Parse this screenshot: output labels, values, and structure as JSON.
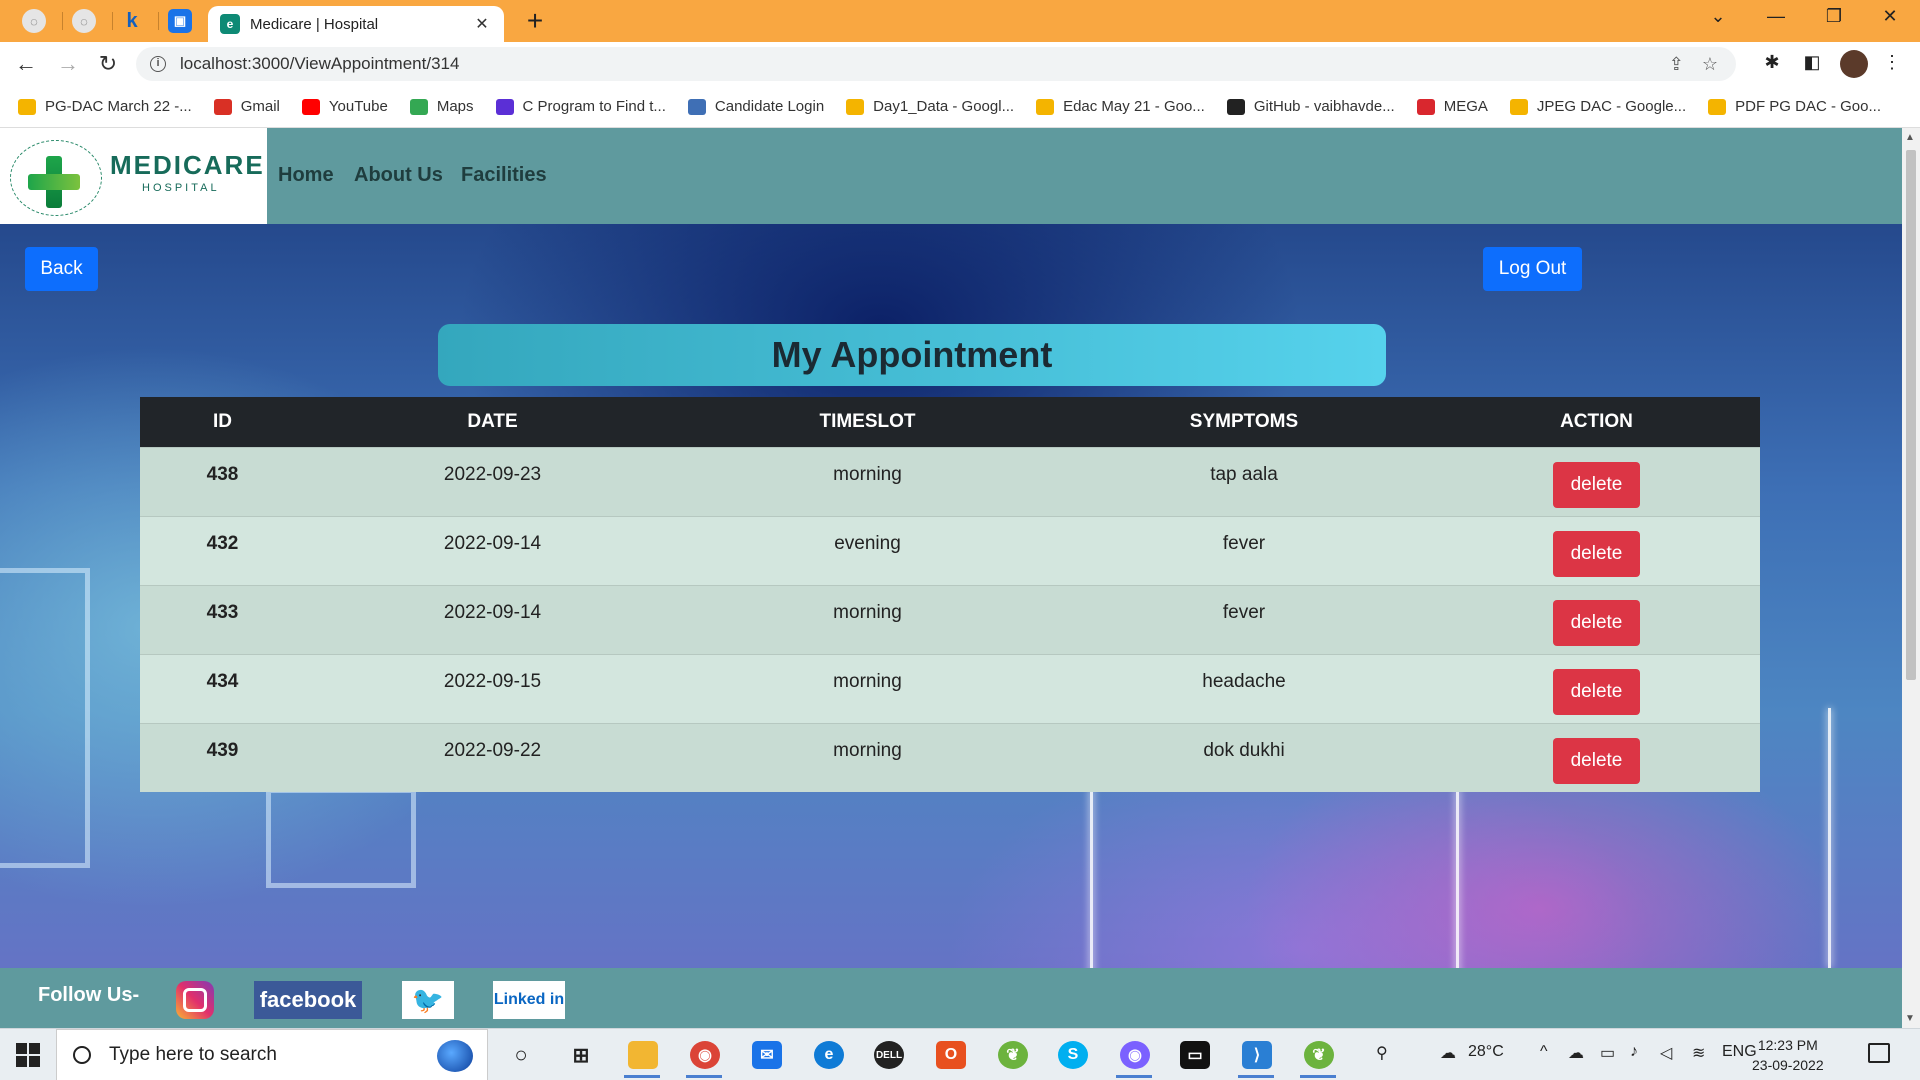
{
  "browser": {
    "active_tab_title": "Medicare | Hospital",
    "url": "localhost:3000/ViewAppointment/314",
    "bookmarks": [
      {
        "label": "PG-DAC March 22 -...",
        "icon": "google-drive-icon",
        "color": "#f4b400"
      },
      {
        "label": "Gmail",
        "icon": "gmail-icon",
        "color": "#d93025"
      },
      {
        "label": "YouTube",
        "icon": "youtube-icon",
        "color": "#ff0000"
      },
      {
        "label": "Maps",
        "icon": "maps-icon",
        "color": "#34a853"
      },
      {
        "label": "C Program to Find t...",
        "icon": "programiz-icon",
        "color": "#5b2fd6"
      },
      {
        "label": "Candidate Login",
        "icon": "cdac-icon",
        "color": "#3f6fb5"
      },
      {
        "label": "Day1_Data - Googl...",
        "icon": "google-drive-icon",
        "color": "#f4b400"
      },
      {
        "label": "Edac May 21 - Goo...",
        "icon": "google-drive-icon",
        "color": "#f4b400"
      },
      {
        "label": "GitHub - vaibhavde...",
        "icon": "github-icon",
        "color": "#222222"
      },
      {
        "label": "MEGA",
        "icon": "mega-icon",
        "color": "#d9272e"
      },
      {
        "label": "JPEG DAC - Google...",
        "icon": "google-drive-icon",
        "color": "#f4b400"
      },
      {
        "label": "PDF PG DAC - Goo...",
        "icon": "google-drive-icon",
        "color": "#f4b400"
      }
    ]
  },
  "site": {
    "logo_title": "MEDICARE",
    "logo_subtitle": "HOSPITAL",
    "logo_ring_text": "HEALING HANDS CARING HEARTS",
    "nav": [
      "Home",
      "About Us",
      "Facilities"
    ],
    "back_label": "Back",
    "logout_label": "Log Out",
    "heading": "My Appointment",
    "columns": [
      "ID",
      "DATE",
      "TIMESLOT",
      "SYMPTOMS",
      "ACTION"
    ],
    "rows": [
      {
        "id": "438",
        "date": "2022-09-23",
        "timeslot": "morning",
        "symptoms": "tap aala",
        "action": "delete"
      },
      {
        "id": "432",
        "date": "2022-09-14",
        "timeslot": "evening",
        "symptoms": "fever",
        "action": "delete"
      },
      {
        "id": "433",
        "date": "2022-09-14",
        "timeslot": "morning",
        "symptoms": "fever",
        "action": "delete"
      },
      {
        "id": "434",
        "date": "2022-09-15",
        "timeslot": "morning",
        "symptoms": "headache",
        "action": "delete"
      },
      {
        "id": "439",
        "date": "2022-09-22",
        "timeslot": "morning",
        "symptoms": "dok dukhi",
        "action": "delete"
      }
    ],
    "footer": {
      "follow_label": "Follow Us-",
      "facebook": "facebook",
      "linkedin": "Linked in"
    },
    "colors": {
      "primary": "#0d6efd",
      "danger": "#dc3545",
      "header": "#5f9a9e",
      "table_head": "#212529"
    }
  },
  "taskbar": {
    "search_placeholder": "Type here to search",
    "temperature": "28°C",
    "language": "ENG",
    "time": "12:23 PM",
    "date": "23-09-2022"
  }
}
